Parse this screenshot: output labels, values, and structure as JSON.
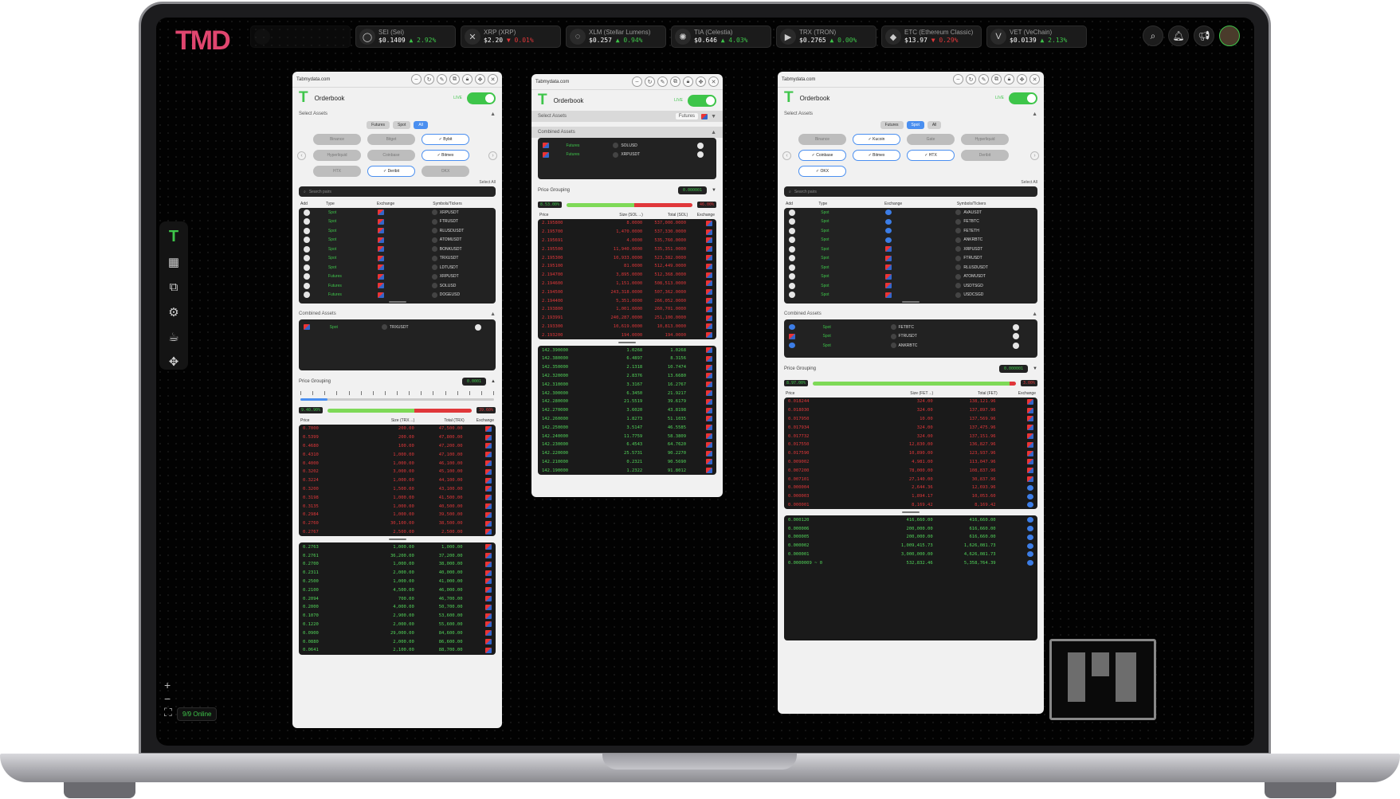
{
  "brand": {
    "logo": "TMD"
  },
  "tickers": [
    {
      "name": "",
      "value": "",
      "change": "",
      "dir": "up",
      "icon": "",
      "faded": true
    },
    {
      "name": "SEI (Sei)",
      "value": "$0.1409",
      "change": "▲ 2.92%",
      "dir": "up",
      "icon": "◯",
      "faded": false
    },
    {
      "name": "XRP (XRP)",
      "value": "$2.20",
      "change": "▼ 0.01%",
      "dir": "dn",
      "icon": "✕",
      "faded": false
    },
    {
      "name": "XLM (Stellar Lumens)",
      "value": "$0.257",
      "change": "▲ 0.94%",
      "dir": "up",
      "icon": "◌",
      "faded": false
    },
    {
      "name": "TIA (Celestia)",
      "value": "$0.646",
      "change": "▲ 4.03%",
      "dir": "up",
      "icon": "✺",
      "faded": false
    },
    {
      "name": "TRX (TRON)",
      "value": "$0.2765",
      "change": "▲ 0.00%",
      "dir": "up",
      "icon": "▶",
      "faded": false
    },
    {
      "name": "ETC (Ethereum Classic)",
      "value": "$13.97",
      "change": "▼ 0.29%",
      "dir": "dn",
      "icon": "◆",
      "faded": false
    },
    {
      "name": "VET (VeChain)",
      "value": "$0.0139",
      "change": "▲ 2.13%",
      "dir": "up",
      "icon": "V",
      "faded": false
    }
  ],
  "top_icons": [
    "search-icon",
    "bell-icon",
    "megaphone-icon",
    "avatar"
  ],
  "rail": {
    "zoom_in": "+",
    "zoom_out": "−",
    "fit": "⛶",
    "online": "9/9 Online"
  },
  "panels": [
    {
      "url": "Tabmydata.com",
      "title": "Orderbook",
      "live": "LIVE",
      "select_assets": "Select Assets",
      "markets": [
        "Futures",
        "Spot",
        "All"
      ],
      "market_selected": 2,
      "exchanges": [
        {
          "label": "Binance",
          "sel": false
        },
        {
          "label": "Bitget",
          "sel": false
        },
        {
          "label": "Bybit",
          "sel": true
        },
        {
          "label": "Hyperliquid",
          "sel": false
        },
        {
          "label": "Coinbase",
          "sel": false
        },
        {
          "label": "Bitmex",
          "sel": true
        },
        {
          "label": "HTX",
          "sel": false
        },
        {
          "label": "Deribit",
          "sel": true
        },
        {
          "label": "OKX",
          "sel": false
        }
      ],
      "select_all": "Select All",
      "search_placeholder": "Search pairs",
      "headers": [
        "Add",
        "Type",
        "Exchange",
        "Symbols/Tickers"
      ],
      "pairs": [
        {
          "type": "Spot",
          "symbol": "XRPUSDT"
        },
        {
          "type": "Spot",
          "symbol": "FTRUSDT"
        },
        {
          "type": "Spot",
          "symbol": "RLUSDUSDT"
        },
        {
          "type": "Spot",
          "symbol": "ATOMUSDT"
        },
        {
          "type": "Spot",
          "symbol": "BONKUSDT"
        },
        {
          "type": "Spot",
          "symbol": "TRXUSDT"
        },
        {
          "type": "Spot",
          "symbol": "LDTUSDT"
        },
        {
          "type": "Futures",
          "symbol": "XRPUSDT"
        },
        {
          "type": "Futures",
          "symbol": "SOLUSD"
        },
        {
          "type": "Futures",
          "symbol": "DOGEUSD"
        }
      ],
      "combined_title": "Combined Assets",
      "combined": [
        {
          "type": "Spot",
          "symbol": "TRXUSDT"
        }
      ],
      "grouping_label": "Price Grouping",
      "grouping_value": "0.0001",
      "ratio_left": "9.40.90%",
      "ratio_right": "39.60%",
      "ratio_green": 0.6,
      "book_headers": [
        "Price",
        "Size (TRX→)",
        "Total (TRX)",
        "Exchange"
      ],
      "asks": [
        [
          "0.7000",
          "200.00",
          "47,500.00"
        ],
        [
          "0.5399",
          "200.00",
          "47,800.00"
        ],
        [
          "0.4680",
          "100.00",
          "47,200.00"
        ],
        [
          "0.4310",
          "1,000.00",
          "47,100.00"
        ],
        [
          "0.4000",
          "1,000.00",
          "46,100.00"
        ],
        [
          "0.3202",
          "3,000.00",
          "45,100.00"
        ],
        [
          "0.3224",
          "1,000.00",
          "44,100.00"
        ],
        [
          "0.3200",
          "1,500.00",
          "43,100.00"
        ],
        [
          "0.3198",
          "1,000.00",
          "41,500.00"
        ],
        [
          "0.3135",
          "1,000.00",
          "40,500.00"
        ],
        [
          "0.2984",
          "1,000.00",
          "39,500.00"
        ],
        [
          "0.2760",
          "30,100.00",
          "38,500.00"
        ],
        [
          "0.2767",
          "2,500.00",
          "2,500.00"
        ]
      ],
      "bids": [
        [
          "0.2763",
          "1,000.00",
          "1,000.00"
        ],
        [
          "0.2761",
          "36,200.00",
          "37,200.00"
        ],
        [
          "0.2700",
          "1,000.00",
          "38,000.00"
        ],
        [
          "0.2311",
          "2,000.00",
          "40,000.00"
        ],
        [
          "0.2500",
          "1,000.00",
          "41,000.00"
        ],
        [
          "0.2100",
          "4,500.00",
          "46,000.00"
        ],
        [
          "0.2094",
          "700.00",
          "46,700.00"
        ],
        [
          "0.2000",
          "4,000.00",
          "50,700.00"
        ],
        [
          "0.1070",
          "2,900.00",
          "53,600.00"
        ],
        [
          "0.1220",
          "2,000.00",
          "55,600.00"
        ],
        [
          "0.0900",
          "29,000.00",
          "84,600.00"
        ],
        [
          "0.0880",
          "2,000.00",
          "86,600.00"
        ],
        [
          "0.0641",
          "2,100.00",
          "88,700.00"
        ]
      ]
    },
    {
      "url": "Tabmydata.com",
      "title": "Orderbook",
      "live": "LIVE",
      "select_assets": "Select Assets",
      "futures_chip": "Futures",
      "combined_title": "Combined Assets",
      "combined": [
        {
          "type": "Futures",
          "symbol": "SOLUSD"
        },
        {
          "type": "Futures",
          "symbol": "XRPUSDT"
        }
      ],
      "grouping_label": "Price Grouping",
      "grouping_value": "0.000001",
      "ratio_left": "8.53.00%",
      "ratio_right": "46.00%",
      "ratio_green": 0.54,
      "book_headers": [
        "Price",
        "Size (SOL→)",
        "Total (SOL)",
        "Exchange"
      ],
      "asks": [
        [
          "2.195800",
          "8.0000",
          "537,000.0000"
        ],
        [
          "2.195700",
          "1,470.0000",
          "537,330.0000"
        ],
        [
          "2.195691",
          "4.0000",
          "535,760.0000"
        ],
        [
          "2.195500",
          "11,940.0000",
          "535,351.0000"
        ],
        [
          "2.195300",
          "10,933.0000",
          "523,382.0000"
        ],
        [
          "2.195100",
          "81.0000",
          "512,449.0000"
        ],
        [
          "2.194700",
          "3,895.0000",
          "512,368.0000"
        ],
        [
          "2.194600",
          "1,151.0000",
          "508,513.0000"
        ],
        [
          "2.194500",
          "243,318.0000",
          "507,362.0000"
        ],
        [
          "2.194400",
          "5,351.0000",
          "266,052.0000"
        ],
        [
          "2.193800",
          "1,001.0000",
          "260,701.0000"
        ],
        [
          "2.193991",
          "240,287.0000",
          "251,100.0000"
        ],
        [
          "2.193300",
          "10,619.0000",
          "10,813.0000"
        ],
        [
          "2.193200",
          "194.0000",
          "194.0000"
        ]
      ],
      "bids": [
        [
          "142.390000",
          "1.0268",
          "1.0268"
        ],
        [
          "142.380000",
          "6.4897",
          "8.3156"
        ],
        [
          "142.350000",
          "2.1318",
          "10.7474"
        ],
        [
          "142.320000",
          "2.8376",
          "13.6680"
        ],
        [
          "142.310000",
          "3.3167",
          "16.2767"
        ],
        [
          "142.300000",
          "6.3450",
          "21.9217"
        ],
        [
          "142.280000",
          "21.5519",
          "39.6179"
        ],
        [
          "142.270000",
          "3.6020",
          "43.8198"
        ],
        [
          "142.260000",
          "1.8273",
          "51.1035"
        ],
        [
          "142.250000",
          "3.5147",
          "46.5585"
        ],
        [
          "142.240000",
          "11.7759",
          "58.3809"
        ],
        [
          "142.230000",
          "6.4543",
          "64.7620"
        ],
        [
          "142.220000",
          "25.5731",
          "90.2270"
        ],
        [
          "142.210000",
          "0.2321",
          "90.5690"
        ],
        [
          "142.190000",
          "1.2322",
          "91.8012"
        ]
      ]
    },
    {
      "url": "Tabmydata.com",
      "title": "Orderbook",
      "live": "LIVE",
      "select_assets": "Select Assets",
      "markets": [
        "Futures",
        "Spot",
        "All"
      ],
      "market_selected": 1,
      "exchanges": [
        {
          "label": "Binance",
          "sel": false
        },
        {
          "label": "Kucoin",
          "sel": true
        },
        {
          "label": "Gate",
          "sel": false
        },
        {
          "label": "Hyperliquid",
          "sel": false
        },
        {
          "label": "Coinbase",
          "sel": true
        },
        {
          "label": "Bitmex",
          "sel": true
        },
        {
          "label": "HTX",
          "sel": true
        },
        {
          "label": "Deribit",
          "sel": false
        },
        {
          "label": "OKX",
          "sel": true
        }
      ],
      "select_all": "Select All",
      "search_placeholder": "Search pairs",
      "headers": [
        "Add",
        "Type",
        "Exchange",
        "Symbols/Tickers"
      ],
      "pairs": [
        {
          "type": "Spot",
          "symbol": "AVAUSDT"
        },
        {
          "type": "Spot",
          "symbol": "FETBTC"
        },
        {
          "type": "Spot",
          "symbol": "FETETH"
        },
        {
          "type": "Spot",
          "symbol": "ANKRBTC"
        },
        {
          "type": "Spot",
          "symbol": "XRPUSDT"
        },
        {
          "type": "Spot",
          "symbol": "FTRUSDT"
        },
        {
          "type": "Spot",
          "symbol": "RLUSDUSDT"
        },
        {
          "type": "Spot",
          "symbol": "ATOMUSDT"
        },
        {
          "type": "Spot",
          "symbol": "USDTSGD"
        },
        {
          "type": "Spot",
          "symbol": "USDCSGD"
        }
      ],
      "combined_title": "Combined Assets",
      "combined": [
        {
          "type": "Spot",
          "symbol": "FETBTC"
        },
        {
          "type": "Spot",
          "symbol": "FTRUSDT"
        },
        {
          "type": "Spot",
          "symbol": "ANKRBTC"
        }
      ],
      "grouping_label": "Price Grouping",
      "grouping_value": "0.000001",
      "ratio_left": "8.97.00%",
      "ratio_right": "3.00%",
      "ratio_green": 0.97,
      "book_headers": [
        "Price",
        "Size (FET→)",
        "Total (FET)",
        "Exchange"
      ],
      "asks": [
        [
          "0.018244",
          "324.00",
          "138,121.96"
        ],
        [
          "0.018030",
          "324.00",
          "137,897.96"
        ],
        [
          "0.017950",
          "10.00",
          "137,569.96"
        ],
        [
          "0.017934",
          "324.00",
          "137,475.96"
        ],
        [
          "0.017732",
          "324.00",
          "137,151.96"
        ],
        [
          "0.017550",
          "12,830.00",
          "136,827.96"
        ],
        [
          "0.017590",
          "10,890.00",
          "123,937.96"
        ],
        [
          "0.009002",
          "4,981.00",
          "113,047.96"
        ],
        [
          "0.007200",
          "78,000.00",
          "108,837.96"
        ],
        [
          "0.007101",
          "27,140.00",
          "30,837.96"
        ],
        [
          "0.000004",
          "2,644.36",
          "12,693.96"
        ],
        [
          "0.000003",
          "1,894.17",
          "10,053.60"
        ],
        [
          "0.000001",
          "8,169.42",
          "8,169.42"
        ]
      ],
      "bids": [
        [
          "0.000120",
          "416,660.00",
          "416,660.00"
        ],
        [
          "0.000006",
          "200,000.00",
          "616,660.00"
        ],
        [
          "0.000005",
          "200,000.00",
          "616,660.00"
        ],
        [
          "0.000002",
          "1,009,415.73",
          "1,626,081.73"
        ],
        [
          "0.000001",
          "3,000,000.00",
          "4,626,081.73"
        ],
        [
          "0.0000009 ~ 0",
          "532,832.46",
          "5,358,764.39"
        ]
      ]
    }
  ]
}
